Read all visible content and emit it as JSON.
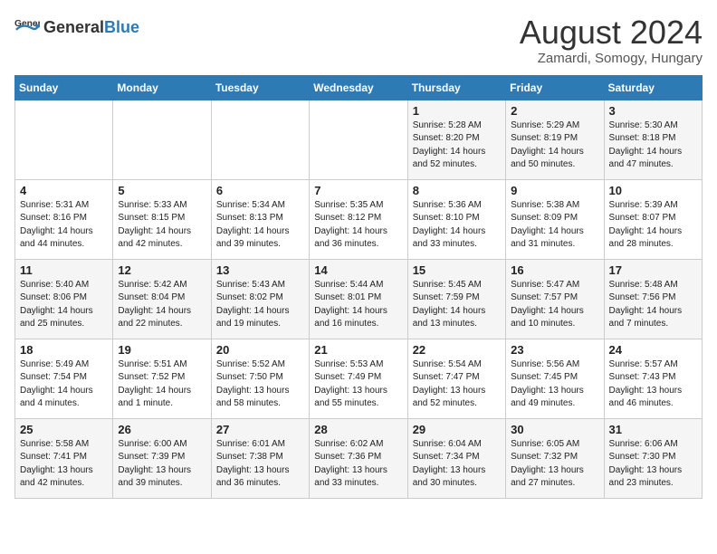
{
  "header": {
    "logo_general": "General",
    "logo_blue": "Blue",
    "month_year": "August 2024",
    "location": "Zamardi, Somogy, Hungary"
  },
  "days_of_week": [
    "Sunday",
    "Monday",
    "Tuesday",
    "Wednesday",
    "Thursday",
    "Friday",
    "Saturday"
  ],
  "weeks": [
    [
      {
        "day": "",
        "info": ""
      },
      {
        "day": "",
        "info": ""
      },
      {
        "day": "",
        "info": ""
      },
      {
        "day": "",
        "info": ""
      },
      {
        "day": "1",
        "info": "Sunrise: 5:28 AM\nSunset: 8:20 PM\nDaylight: 14 hours\nand 52 minutes."
      },
      {
        "day": "2",
        "info": "Sunrise: 5:29 AM\nSunset: 8:19 PM\nDaylight: 14 hours\nand 50 minutes."
      },
      {
        "day": "3",
        "info": "Sunrise: 5:30 AM\nSunset: 8:18 PM\nDaylight: 14 hours\nand 47 minutes."
      }
    ],
    [
      {
        "day": "4",
        "info": "Sunrise: 5:31 AM\nSunset: 8:16 PM\nDaylight: 14 hours\nand 44 minutes."
      },
      {
        "day": "5",
        "info": "Sunrise: 5:33 AM\nSunset: 8:15 PM\nDaylight: 14 hours\nand 42 minutes."
      },
      {
        "day": "6",
        "info": "Sunrise: 5:34 AM\nSunset: 8:13 PM\nDaylight: 14 hours\nand 39 minutes."
      },
      {
        "day": "7",
        "info": "Sunrise: 5:35 AM\nSunset: 8:12 PM\nDaylight: 14 hours\nand 36 minutes."
      },
      {
        "day": "8",
        "info": "Sunrise: 5:36 AM\nSunset: 8:10 PM\nDaylight: 14 hours\nand 33 minutes."
      },
      {
        "day": "9",
        "info": "Sunrise: 5:38 AM\nSunset: 8:09 PM\nDaylight: 14 hours\nand 31 minutes."
      },
      {
        "day": "10",
        "info": "Sunrise: 5:39 AM\nSunset: 8:07 PM\nDaylight: 14 hours\nand 28 minutes."
      }
    ],
    [
      {
        "day": "11",
        "info": "Sunrise: 5:40 AM\nSunset: 8:06 PM\nDaylight: 14 hours\nand 25 minutes."
      },
      {
        "day": "12",
        "info": "Sunrise: 5:42 AM\nSunset: 8:04 PM\nDaylight: 14 hours\nand 22 minutes."
      },
      {
        "day": "13",
        "info": "Sunrise: 5:43 AM\nSunset: 8:02 PM\nDaylight: 14 hours\nand 19 minutes."
      },
      {
        "day": "14",
        "info": "Sunrise: 5:44 AM\nSunset: 8:01 PM\nDaylight: 14 hours\nand 16 minutes."
      },
      {
        "day": "15",
        "info": "Sunrise: 5:45 AM\nSunset: 7:59 PM\nDaylight: 14 hours\nand 13 minutes."
      },
      {
        "day": "16",
        "info": "Sunrise: 5:47 AM\nSunset: 7:57 PM\nDaylight: 14 hours\nand 10 minutes."
      },
      {
        "day": "17",
        "info": "Sunrise: 5:48 AM\nSunset: 7:56 PM\nDaylight: 14 hours\nand 7 minutes."
      }
    ],
    [
      {
        "day": "18",
        "info": "Sunrise: 5:49 AM\nSunset: 7:54 PM\nDaylight: 14 hours\nand 4 minutes."
      },
      {
        "day": "19",
        "info": "Sunrise: 5:51 AM\nSunset: 7:52 PM\nDaylight: 14 hours\nand 1 minute."
      },
      {
        "day": "20",
        "info": "Sunrise: 5:52 AM\nSunset: 7:50 PM\nDaylight: 13 hours\nand 58 minutes."
      },
      {
        "day": "21",
        "info": "Sunrise: 5:53 AM\nSunset: 7:49 PM\nDaylight: 13 hours\nand 55 minutes."
      },
      {
        "day": "22",
        "info": "Sunrise: 5:54 AM\nSunset: 7:47 PM\nDaylight: 13 hours\nand 52 minutes."
      },
      {
        "day": "23",
        "info": "Sunrise: 5:56 AM\nSunset: 7:45 PM\nDaylight: 13 hours\nand 49 minutes."
      },
      {
        "day": "24",
        "info": "Sunrise: 5:57 AM\nSunset: 7:43 PM\nDaylight: 13 hours\nand 46 minutes."
      }
    ],
    [
      {
        "day": "25",
        "info": "Sunrise: 5:58 AM\nSunset: 7:41 PM\nDaylight: 13 hours\nand 42 minutes."
      },
      {
        "day": "26",
        "info": "Sunrise: 6:00 AM\nSunset: 7:39 PM\nDaylight: 13 hours\nand 39 minutes."
      },
      {
        "day": "27",
        "info": "Sunrise: 6:01 AM\nSunset: 7:38 PM\nDaylight: 13 hours\nand 36 minutes."
      },
      {
        "day": "28",
        "info": "Sunrise: 6:02 AM\nSunset: 7:36 PM\nDaylight: 13 hours\nand 33 minutes."
      },
      {
        "day": "29",
        "info": "Sunrise: 6:04 AM\nSunset: 7:34 PM\nDaylight: 13 hours\nand 30 minutes."
      },
      {
        "day": "30",
        "info": "Sunrise: 6:05 AM\nSunset: 7:32 PM\nDaylight: 13 hours\nand 27 minutes."
      },
      {
        "day": "31",
        "info": "Sunrise: 6:06 AM\nSunset: 7:30 PM\nDaylight: 13 hours\nand 23 minutes."
      }
    ]
  ]
}
